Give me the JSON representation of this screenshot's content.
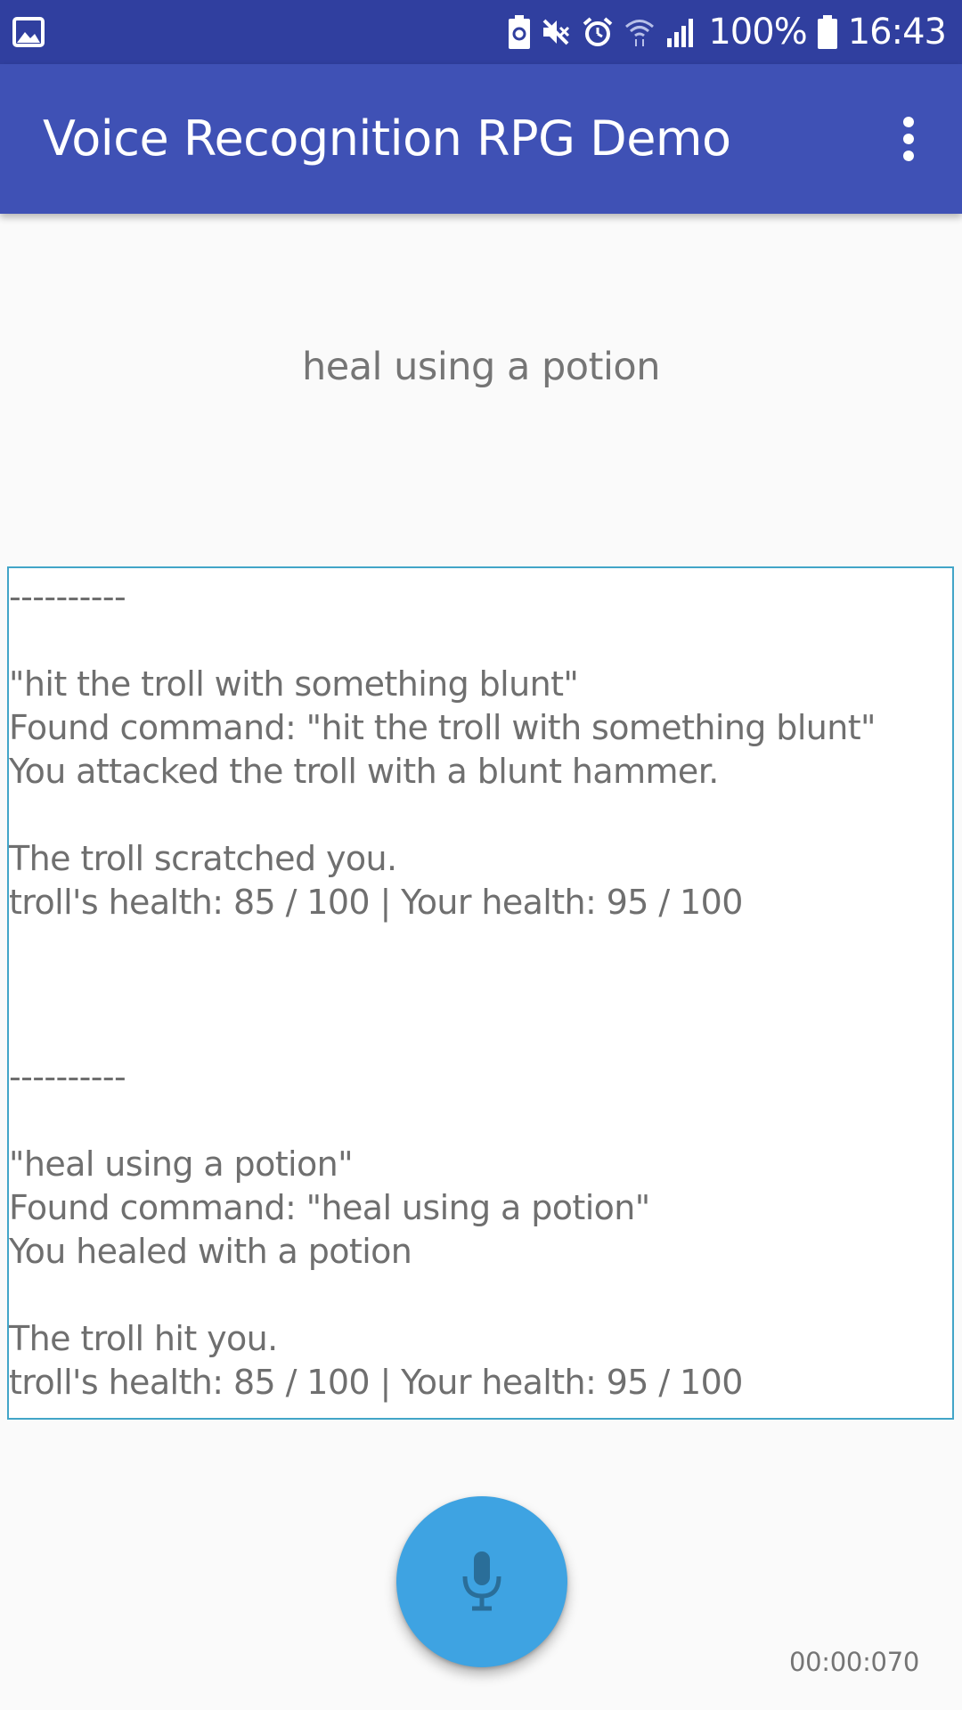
{
  "status_bar": {
    "battery_percent": "100%",
    "time": "16:43",
    "icons": [
      "image-icon",
      "battery-saver-icon",
      "mute-icon",
      "alarm-icon",
      "wifi-icon",
      "signal-icon",
      "battery-icon"
    ]
  },
  "app_bar": {
    "title": "Voice Recognition RPG Demo",
    "overflow_icon": "more-vert-icon"
  },
  "recognized_text": "heal using a potion",
  "log": {
    "text": "----------\n\n\"hit the troll with something blunt\"\nFound command: \"hit the troll with something blunt\"\nYou attacked the troll with a blunt hammer.\n\nThe troll scratched you.\ntroll's health: 85 / 100 | Your health: 95 / 100\n\n\n\n----------\n\n\"heal using a potion\"\nFound command: \"heal using a potion\"\nYou healed with a potion\n\nThe troll hit you.\ntroll's health: 85 / 100 | Your health: 95 / 100"
  },
  "fab": {
    "icon": "microphone-icon"
  },
  "timer": "00:00:070",
  "colors": {
    "status_bar": "#303f9f",
    "app_bar": "#3f51b5",
    "fab": "#3ea3e2",
    "log_border": "#42a5c8",
    "text_secondary": "#757575"
  }
}
